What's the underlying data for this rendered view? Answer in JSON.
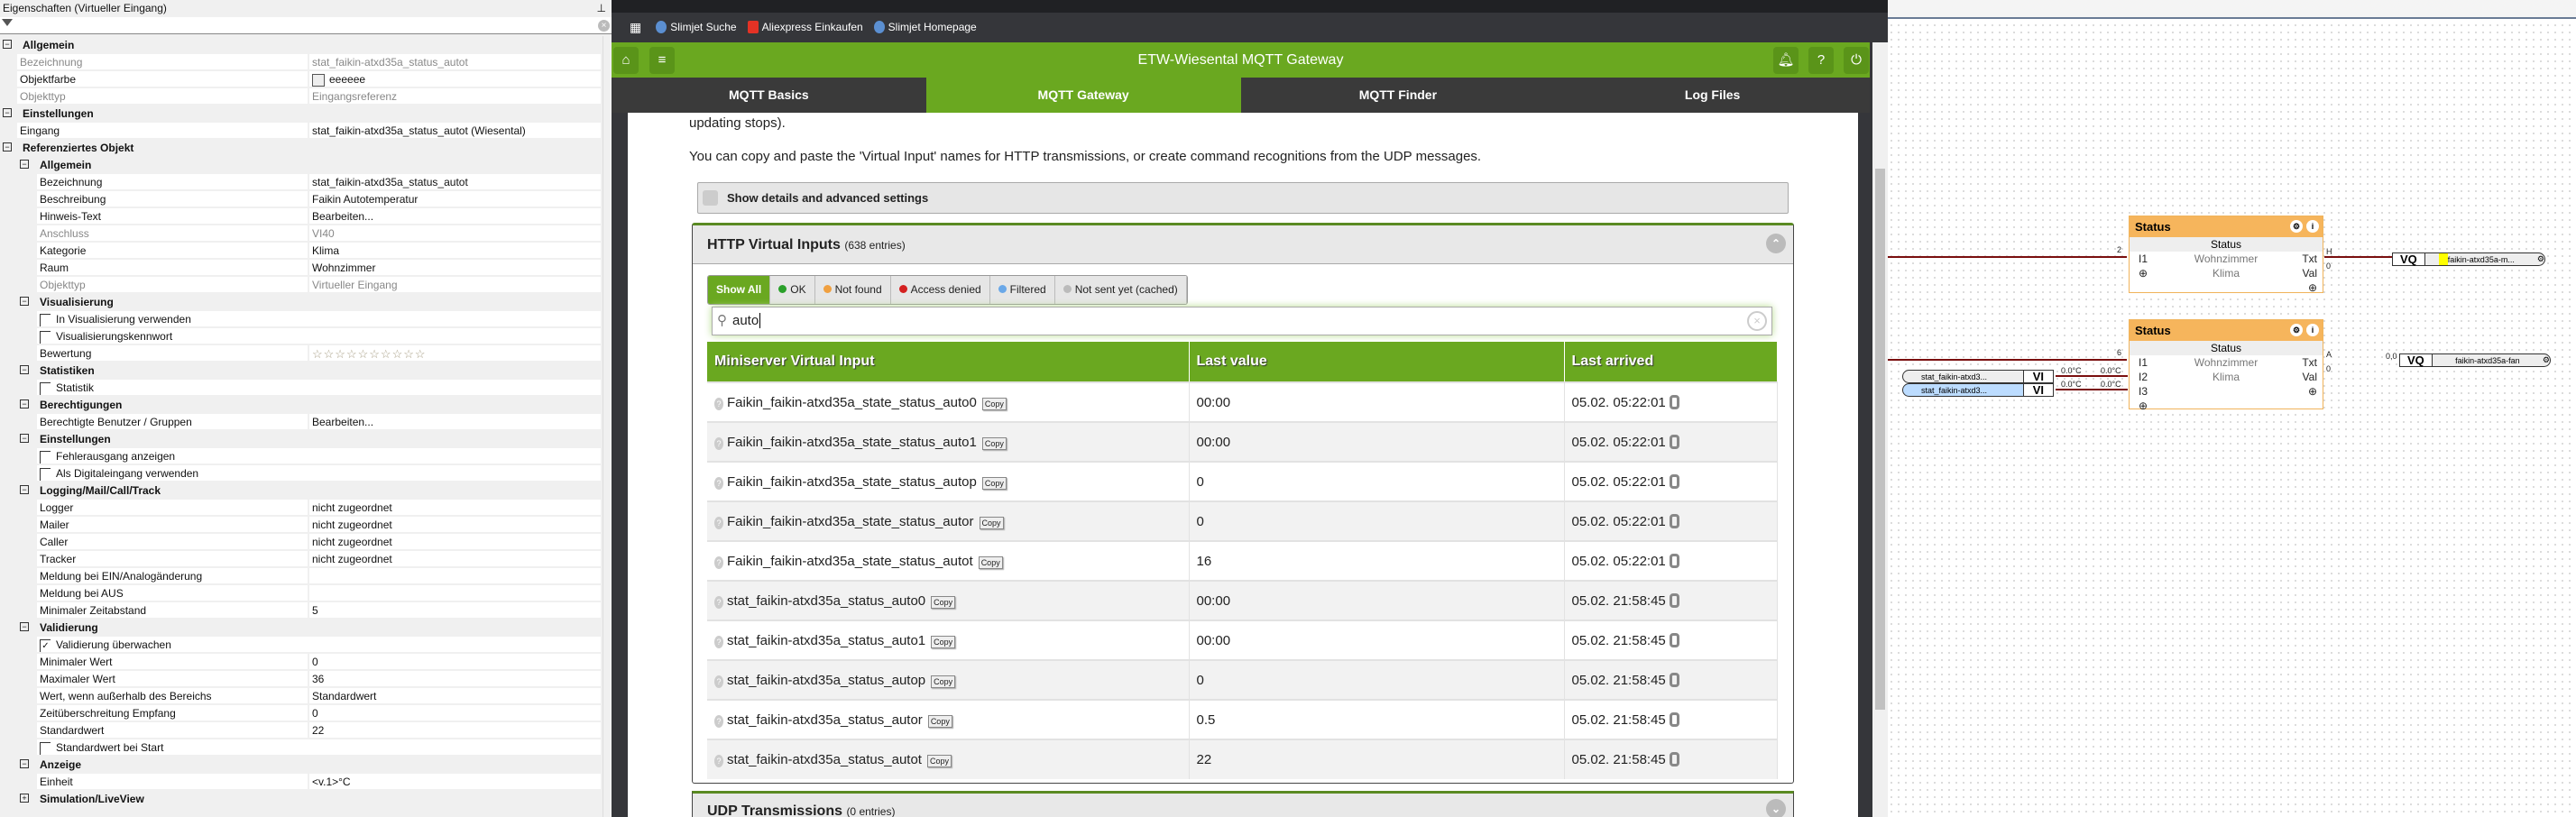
{
  "props": {
    "title": "Eigenschaften (Virtueller Eingang)",
    "rows": [
      {
        "t": "h",
        "lv": 0,
        "label": "Allgemein"
      },
      {
        "t": "p",
        "lv": 1,
        "label": "Bezeichnung",
        "value": "stat_faikin-atxd35a_status_autot",
        "muted": true
      },
      {
        "t": "color",
        "lv": 1,
        "label": "Objektfarbe",
        "value": "eeeeee"
      },
      {
        "t": "p",
        "lv": 1,
        "label": "Objekttyp",
        "value": "Eingangsreferenz",
        "muted": true
      },
      {
        "t": "h",
        "lv": 0,
        "label": "Einstellungen"
      },
      {
        "t": "p",
        "lv": 1,
        "label": "Eingang",
        "value": "stat_faikin-atxd35a_status_autot (Wiesental)"
      },
      {
        "t": "h",
        "lv": 0,
        "label": "Referenziertes Objekt"
      },
      {
        "t": "h",
        "lv": 1,
        "label": "Allgemein"
      },
      {
        "t": "p",
        "lv": 2,
        "label": "Bezeichnung",
        "value": "stat_faikin-atxd35a_status_autot"
      },
      {
        "t": "p",
        "lv": 2,
        "label": "Beschreibung",
        "value": "Faikin Autotemperatur"
      },
      {
        "t": "p",
        "lv": 2,
        "label": "Hinweis-Text",
        "value": "Bearbeiten..."
      },
      {
        "t": "p",
        "lv": 2,
        "label": "Anschluss",
        "value": "VI40",
        "muted": true
      },
      {
        "t": "p",
        "lv": 2,
        "label": "Kategorie",
        "value": "Klima"
      },
      {
        "t": "p",
        "lv": 2,
        "label": "Raum",
        "value": "Wohnzimmer"
      },
      {
        "t": "p",
        "lv": 2,
        "label": "Objekttyp",
        "value": "Virtueller Eingang",
        "muted": true
      },
      {
        "t": "h",
        "lv": 1,
        "label": "Visualisierung"
      },
      {
        "t": "cb",
        "lv": 2,
        "label": "In Visualisierung verwenden",
        "checked": false
      },
      {
        "t": "cb",
        "lv": 2,
        "label": "Visualisierungskennwort",
        "checked": false
      },
      {
        "t": "stars",
        "lv": 2,
        "label": "Bewertung",
        "value": "☆☆☆☆☆☆☆☆☆☆"
      },
      {
        "t": "h",
        "lv": 1,
        "label": "Statistiken"
      },
      {
        "t": "cb",
        "lv": 2,
        "label": "Statistik",
        "checked": false
      },
      {
        "t": "h",
        "lv": 1,
        "label": "Berechtigungen"
      },
      {
        "t": "p",
        "lv": 2,
        "label": "Berechtigte Benutzer / Gruppen",
        "value": "Bearbeiten..."
      },
      {
        "t": "h",
        "lv": 1,
        "label": "Einstellungen"
      },
      {
        "t": "cb",
        "lv": 2,
        "label": "Fehlerausgang anzeigen",
        "checked": false
      },
      {
        "t": "cb",
        "lv": 2,
        "label": "Als Digitaleingang verwenden",
        "checked": false
      },
      {
        "t": "h",
        "lv": 1,
        "label": "Logging/Mail/Call/Track"
      },
      {
        "t": "p",
        "lv": 2,
        "label": "Logger",
        "value": "nicht zugeordnet"
      },
      {
        "t": "p",
        "lv": 2,
        "label": "Mailer",
        "value": "nicht zugeordnet"
      },
      {
        "t": "p",
        "lv": 2,
        "label": "Caller",
        "value": "nicht zugeordnet"
      },
      {
        "t": "p",
        "lv": 2,
        "label": "Tracker",
        "value": "nicht zugeordnet"
      },
      {
        "t": "p",
        "lv": 2,
        "label": "Meldung bei EIN/Analogänderung",
        "value": ""
      },
      {
        "t": "p",
        "lv": 2,
        "label": "Meldung bei AUS",
        "value": ""
      },
      {
        "t": "p",
        "lv": 2,
        "label": "Minimaler Zeitabstand",
        "value": "5"
      },
      {
        "t": "h",
        "lv": 1,
        "label": "Validierung"
      },
      {
        "t": "cb",
        "lv": 2,
        "label": "Validierung überwachen",
        "checked": true
      },
      {
        "t": "p",
        "lv": 2,
        "label": "Minimaler Wert",
        "value": "0"
      },
      {
        "t": "p",
        "lv": 2,
        "label": "Maximaler Wert",
        "value": "36"
      },
      {
        "t": "p",
        "lv": 2,
        "label": "Wert, wenn außerhalb des Bereichs",
        "value": "Standardwert"
      },
      {
        "t": "p",
        "lv": 2,
        "label": "Zeitüberschreitung Empfang",
        "value": "0"
      },
      {
        "t": "p",
        "lv": 2,
        "label": "Standardwert",
        "value": "22"
      },
      {
        "t": "cb",
        "lv": 2,
        "label": "Standardwert bei Start",
        "checked": false
      },
      {
        "t": "h",
        "lv": 1,
        "label": "Anzeige"
      },
      {
        "t": "p",
        "lv": 2,
        "label": "Einheit",
        "value": "<v.1>°C"
      },
      {
        "t": "h",
        "lv": 1,
        "label": "Simulation/LiveView",
        "collapsed": true
      }
    ]
  },
  "browser": {
    "bookmarks": [
      "Slimjet Suche",
      "Aliexpress Einkaufen",
      "Slimjet Homepage"
    ],
    "app_title": "ETW-Wiesental MQTT Gateway",
    "nav": [
      "MQTT Basics",
      "MQTT Gateway",
      "MQTT Finder",
      "Log Files"
    ],
    "active_nav": 1,
    "text1": "updating stops).",
    "text2": "You can copy and paste the 'Virtual Input' names for HTTP transmissions, or create command recognitions from the UDP messages.",
    "details_label": "Show details and advanced settings",
    "http_title": "HTTP Virtual Inputs",
    "http_count": "(638 entries)",
    "filters": [
      {
        "label": "Show All",
        "color": ""
      },
      {
        "label": "OK",
        "color": "#2aa02a"
      },
      {
        "label": "Not found",
        "color": "#f0a040"
      },
      {
        "label": "Access denied",
        "color": "#d42020"
      },
      {
        "label": "Filtered",
        "color": "#6aa8e8"
      },
      {
        "label": "Not sent yet (cached)",
        "color": "#bbbbbb"
      }
    ],
    "search_value": "auto",
    "columns": [
      "Miniserver Virtual Input",
      "Last value",
      "Last arrived"
    ],
    "copy_label": "Copy",
    "rows": [
      {
        "name": "Faikin_faikin-atxd35a_state_status_auto0",
        "value": "00:00",
        "arrived": "05.02. 05:22:01"
      },
      {
        "name": "Faikin_faikin-atxd35a_state_status_auto1",
        "value": "00:00",
        "arrived": "05.02. 05:22:01"
      },
      {
        "name": "Faikin_faikin-atxd35a_state_status_autop",
        "value": "0",
        "arrived": "05.02. 05:22:01"
      },
      {
        "name": "Faikin_faikin-atxd35a_state_status_autor",
        "value": "0",
        "arrived": "05.02. 05:22:01"
      },
      {
        "name": "Faikin_faikin-atxd35a_state_status_autot",
        "value": "16",
        "arrived": "05.02. 05:22:01"
      },
      {
        "name": "stat_faikin-atxd35a_status_auto0",
        "value": "00:00",
        "arrived": "05.02. 21:58:45"
      },
      {
        "name": "stat_faikin-atxd35a_status_auto1",
        "value": "00:00",
        "arrived": "05.02. 21:58:45"
      },
      {
        "name": "stat_faikin-atxd35a_status_autop",
        "value": "0",
        "arrived": "05.02. 21:58:45"
      },
      {
        "name": "stat_faikin-atxd35a_status_autor",
        "value": "0.5",
        "arrived": "05.02. 21:58:45"
      },
      {
        "name": "stat_faikin-atxd35a_status_autot",
        "value": "22",
        "arrived": "05.02. 21:58:45"
      }
    ],
    "udp_title": "UDP Transmissions",
    "udp_count": "(0 entries)"
  },
  "diagram": {
    "block1": {
      "title": "Status",
      "sub": "Status",
      "in1": "I1",
      "room": "Wohnzimmer",
      "cat": "Klima",
      "out1": "Txt",
      "out2": "Val",
      "in_val": "2",
      "txt_val": "H",
      "val_val": "0"
    },
    "block2": {
      "title": "Status",
      "sub": "Status",
      "in1": "I1",
      "in2": "I2",
      "in3": "I3",
      "room": "Wohnzimmer",
      "cat": "Klima",
      "out1": "Txt",
      "out2": "Val",
      "in_val": "6",
      "txt_val": "A",
      "val_val": "0"
    },
    "vq1": {
      "label": "VQ",
      "name": "faikin-atxd35a-m..."
    },
    "vq2": {
      "label": "VQ",
      "name": "faikin-atxd35a-fan",
      "in_val": "0,0"
    },
    "vi1": {
      "label": "VI",
      "name": "stat_faikin-atxd3...",
      "v1": "0.0°C",
      "v2": "0.0°C"
    },
    "vi2": {
      "label": "VI",
      "name": "stat_faikin-atxd3...",
      "v1": "0.0°C",
      "v2": "0.0°C"
    }
  }
}
